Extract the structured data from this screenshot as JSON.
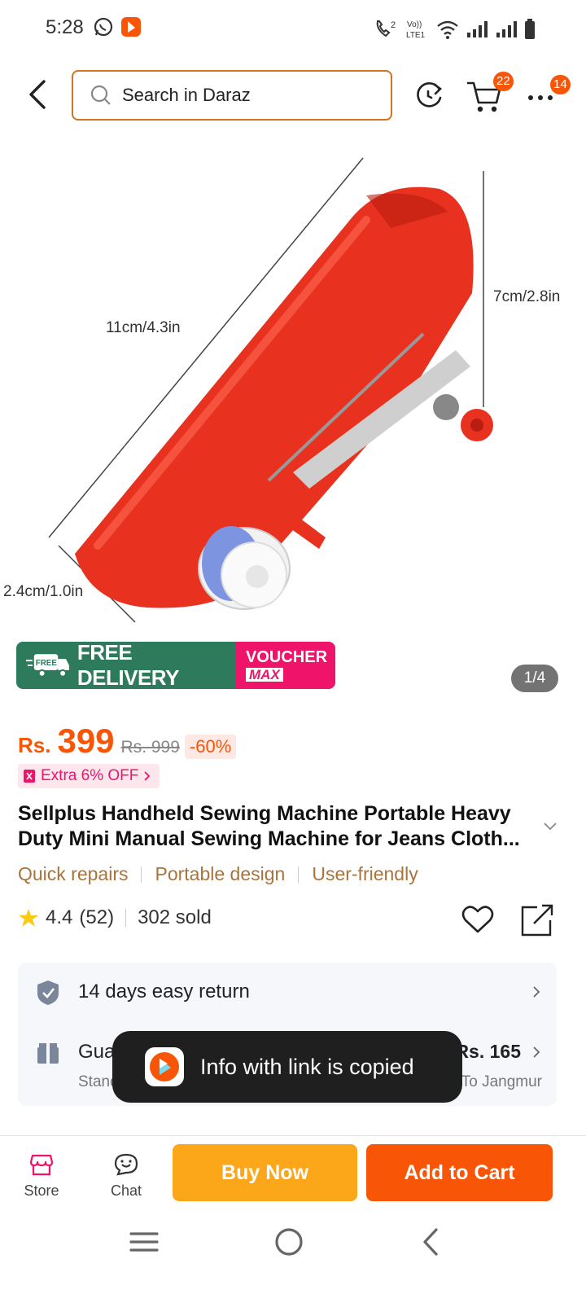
{
  "status_bar": {
    "time": "5:28",
    "lte_label": "LTE1",
    "volte_label": "Vo))",
    "sim_label": "2",
    "icons": [
      "whatsapp-icon",
      "daraz-notify-icon",
      "wifi-call-icon",
      "volte-icon",
      "wifi-icon",
      "signal-icon",
      "signal-icon",
      "battery-icon"
    ]
  },
  "top_nav": {
    "search_placeholder": "Search in Daraz",
    "cart_badge": "22",
    "more_badge": "14"
  },
  "product_image": {
    "dim_length": "11cm/4.3in",
    "dim_height": "7cm/2.8in",
    "dim_width": "2.4cm/1.0in",
    "counter": "1/4"
  },
  "promo": {
    "free_tag": "FREE",
    "free_delivery": "FREE DELIVERY",
    "voucher": "VOUCHER",
    "max": "MAX"
  },
  "price": {
    "currency": "Rs.",
    "value": "399",
    "original": "Rs. 999",
    "discount": "-60%",
    "extra_off": "Extra 6% OFF"
  },
  "product": {
    "title": "Sellplus Handheld Sewing Machine Portable Heavy Duty Mini Manual Sewing Machine for Jeans Cloth...",
    "tags": [
      "Quick repairs",
      "Portable design",
      "User-friendly"
    ],
    "rating": "4.4",
    "reviews": "(52)",
    "sold": "302 sold"
  },
  "services": {
    "return_label": "14 days easy return",
    "delivery_label": "Guaranteed by 20-22 Jan",
    "delivery_sub": "Standard Delivery",
    "delivery_price": "Rs. 165",
    "delivery_to": "To Jangmur"
  },
  "toast": {
    "message": "Info with link is copied"
  },
  "actions": {
    "store": "Store",
    "chat": "Chat",
    "buy_now": "Buy Now",
    "add_to_cart": "Add to Cart"
  },
  "colors": {
    "accent": "#f85606",
    "buy_now": "#fca61a",
    "free_delivery_bg": "#2e7a5c",
    "voucher_bg": "#f0136a",
    "tag_text": "#a8743d"
  }
}
